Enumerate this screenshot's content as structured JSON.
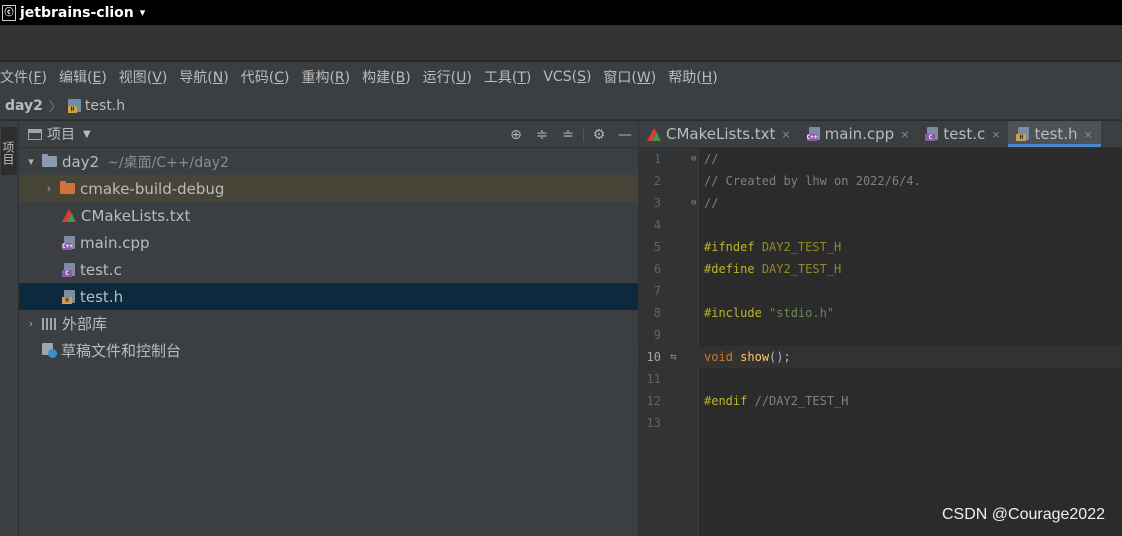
{
  "system_bar": {
    "app_icon_text": "&#x",
    "app_name": "jetbrains-clion",
    "caret": "▾"
  },
  "menu": [
    {
      "label": "文件(",
      "key": "F",
      "end": ")"
    },
    {
      "label": "编辑(",
      "key": "E",
      "end": ")"
    },
    {
      "label": "视图(",
      "key": "V",
      "end": ")"
    },
    {
      "label": "导航(",
      "key": "N",
      "end": ")"
    },
    {
      "label": "代码(",
      "key": "C",
      "end": ")"
    },
    {
      "label": "重构(",
      "key": "R",
      "end": ")"
    },
    {
      "label": "构建(",
      "key": "B",
      "end": ")"
    },
    {
      "label": "运行(",
      "key": "U",
      "end": ")"
    },
    {
      "label": "工具(",
      "key": "T",
      "end": ")"
    },
    {
      "label": "VCS(",
      "key": "S",
      "end": ")"
    },
    {
      "label": "窗口(",
      "key": "W",
      "end": ")"
    },
    {
      "label": "帮助(",
      "key": "H",
      "end": ")"
    }
  ],
  "breadcrumb": {
    "root": "day2",
    "separator": "〉",
    "file": "test.h"
  },
  "side_stripe": {
    "tab_label": "项目"
  },
  "project": {
    "title": "项目",
    "tools": [
      "⊕",
      "≑",
      "≐",
      "⚙",
      "—"
    ],
    "root": {
      "name": "day2",
      "path": "~/桌面/C++/day2"
    },
    "items": [
      {
        "name": "cmake-build-debug",
        "type": "folder"
      },
      {
        "name": "CMakeLists.txt",
        "type": "cmake"
      },
      {
        "name": "main.cpp",
        "type": "cpp",
        "badge": "C++"
      },
      {
        "name": "test.c",
        "type": "c",
        "badge": "C"
      },
      {
        "name": "test.h",
        "type": "h",
        "badge": "H"
      }
    ],
    "external_libs": "外部库",
    "scratches": "草稿文件和控制台"
  },
  "editor": {
    "tabs": [
      {
        "name": "CMakeLists.txt",
        "close": "×"
      },
      {
        "name": "main.cpp",
        "close": "×",
        "badge": "C++"
      },
      {
        "name": "test.c",
        "close": "×",
        "badge": "C"
      },
      {
        "name": "test.h",
        "close": "×",
        "badge": "H",
        "active": true
      }
    ],
    "lines": {
      "n1": "1",
      "n2": "2",
      "n3": "3",
      "n4": "4",
      "n5": "5",
      "n6": "6",
      "n7": "7",
      "n8": "8",
      "n9": "9",
      "n10": "10",
      "n11": "11",
      "n12": "12",
      "n13": "13",
      "l1": "//",
      "l2": "// Created by lhw on 2022/6/4.",
      "l3": "//",
      "l5_kw": "#ifndef",
      "l5_mac": "DAY2_TEST_H",
      "l6_kw": "#define",
      "l6_mac": "DAY2_TEST_H",
      "l8_kw": "#include",
      "l8_str": "\"stdio.h\"",
      "l10_kw": "void",
      "l10_fn": "show",
      "l10_rest": "();",
      "l12_kw": "#endif",
      "l12_cm": "//DAY2_TEST_H"
    }
  },
  "watermark": "CSDN @Courage2022",
  "colors": {
    "bg_editor": "#2b2b2b",
    "bg_panel": "#3c3f41",
    "selection": "#0d293e",
    "keyword": "#cc7832",
    "function": "#ffc66d",
    "string": "#6a8759",
    "comment": "#808080",
    "preprocessor": "#bbb529"
  }
}
